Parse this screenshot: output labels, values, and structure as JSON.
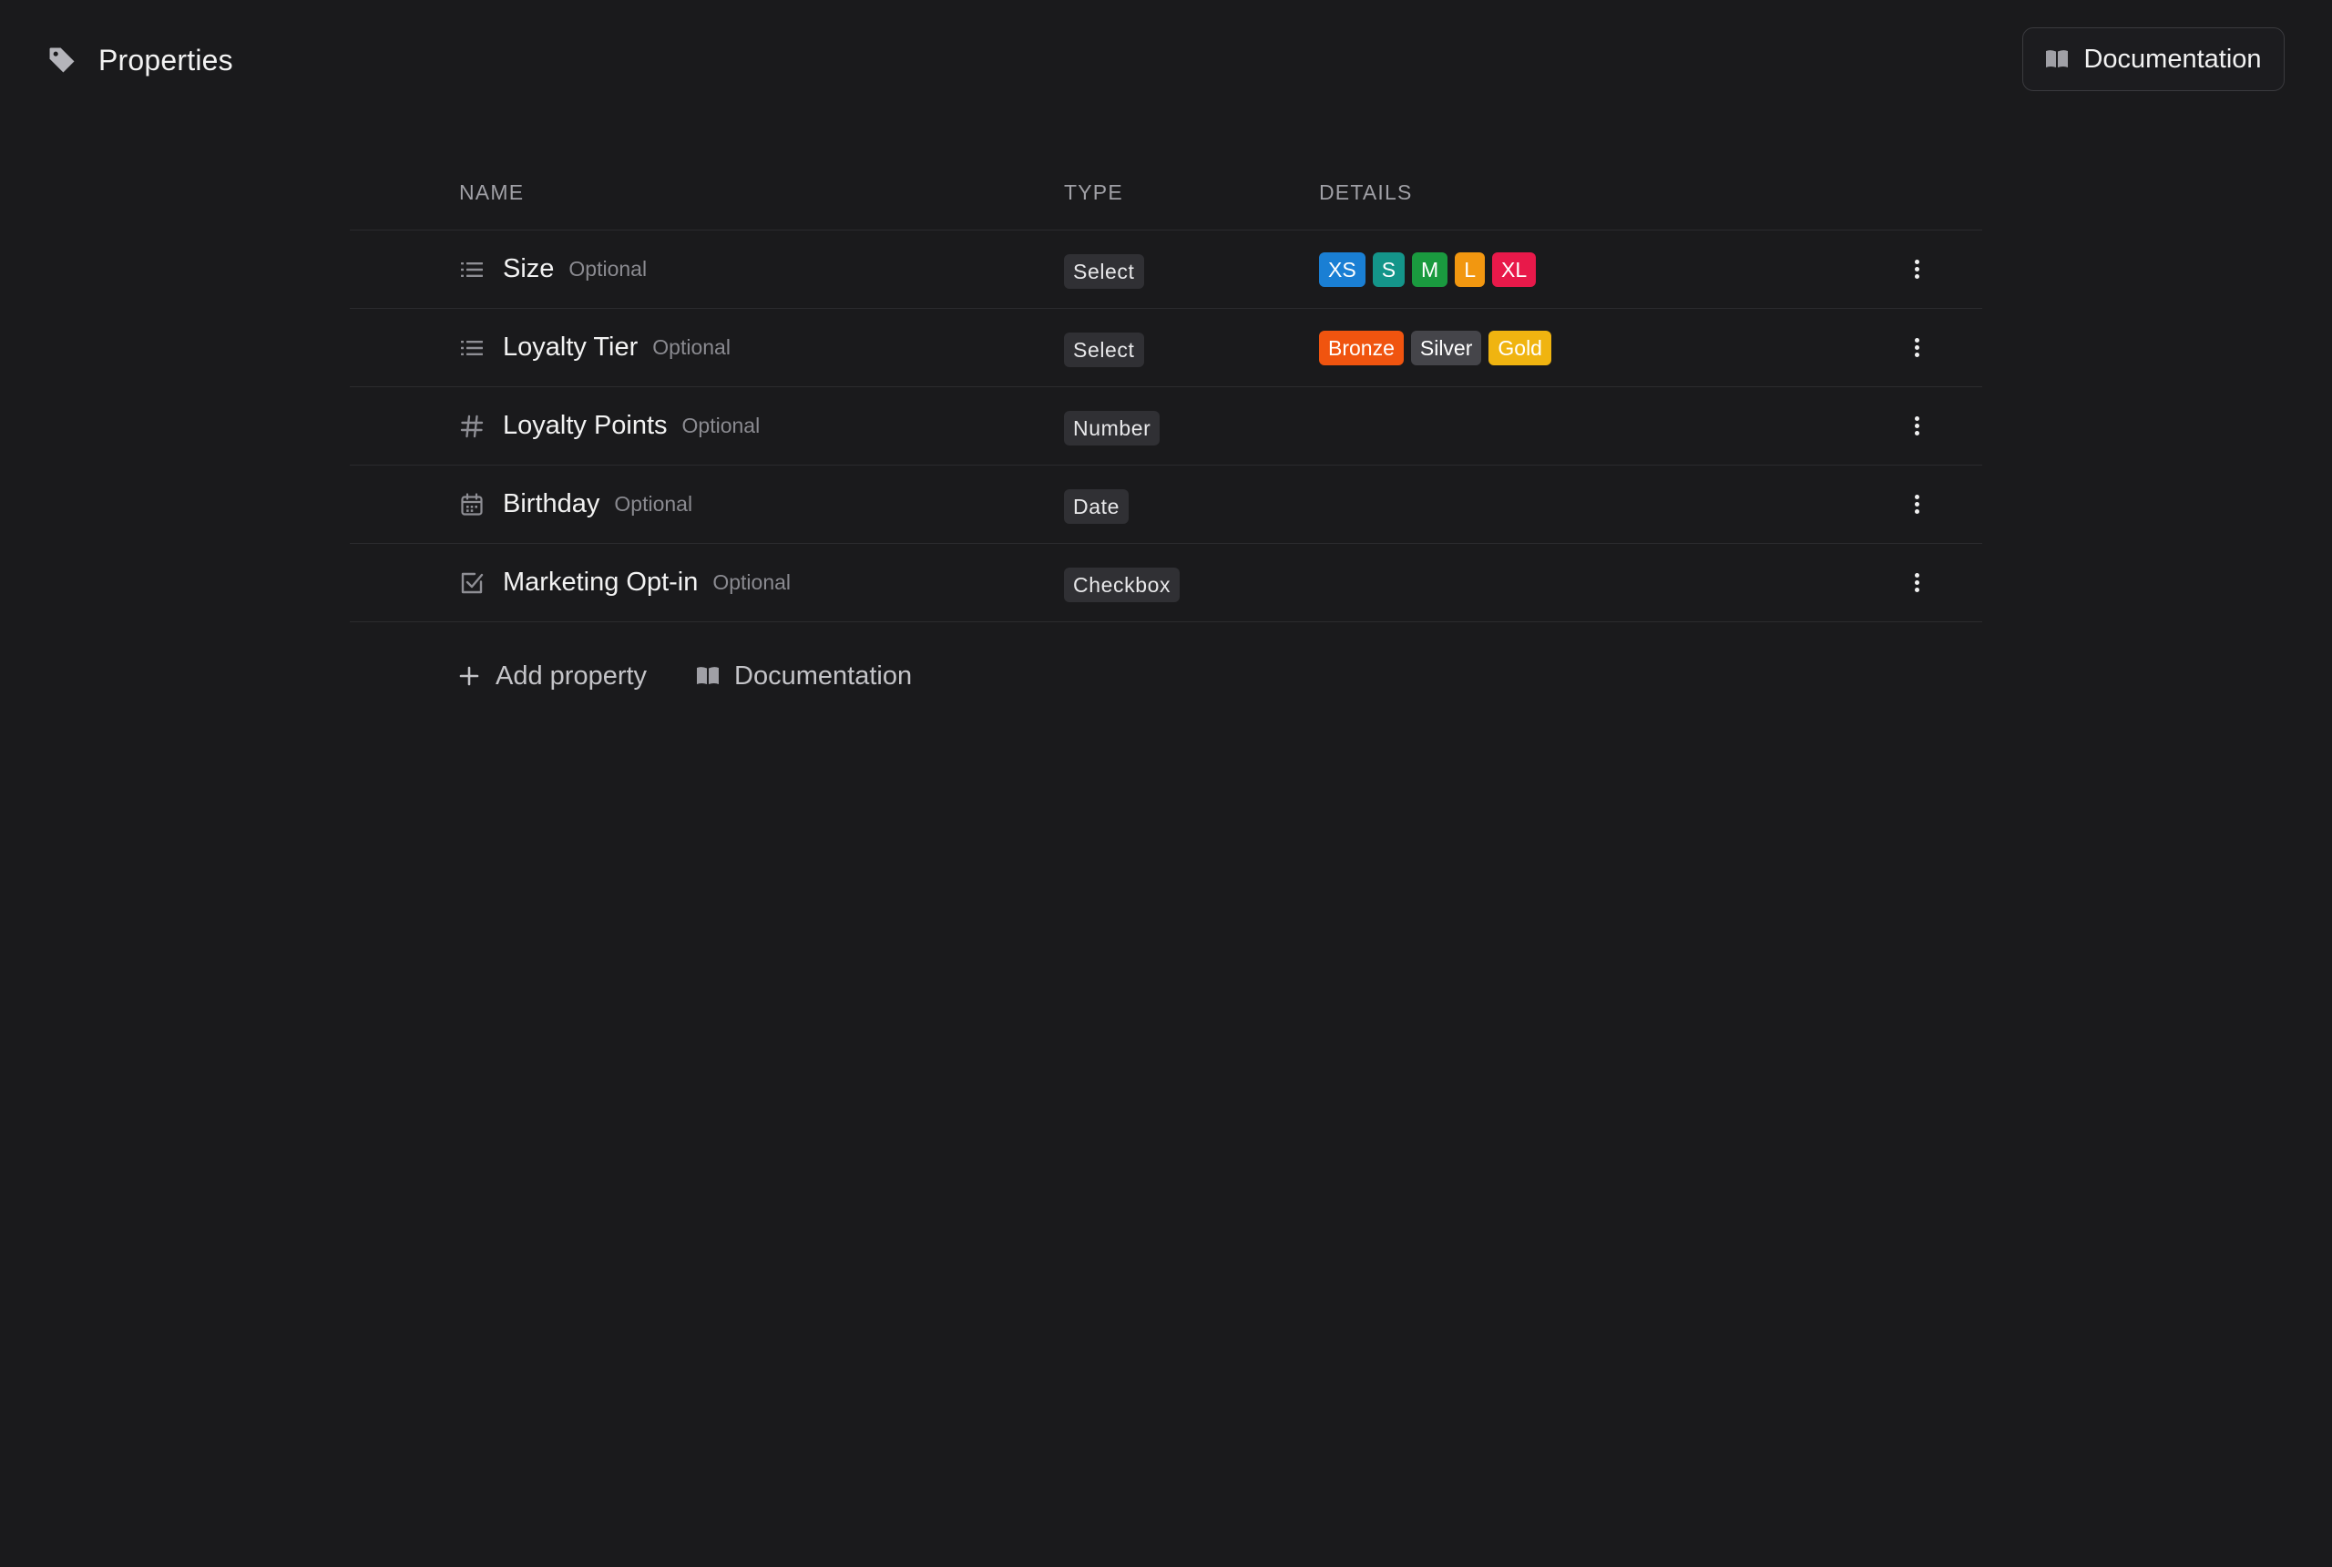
{
  "header": {
    "title": "Properties",
    "title_icon": "tag-icon",
    "documentation_label": "Documentation"
  },
  "table": {
    "columns": [
      "NAME",
      "TYPE",
      "DETAILS"
    ],
    "rows": [
      {
        "icon": "list-icon",
        "name": "Size",
        "optional_label": "Optional",
        "type": "Select",
        "details": [
          {
            "label": "XS",
            "color": "#1a7fd4"
          },
          {
            "label": "S",
            "color": "#14958a"
          },
          {
            "label": "M",
            "color": "#1a9a3f"
          },
          {
            "label": "L",
            "color": "#f29710"
          },
          {
            "label": "XL",
            "color": "#e8194a"
          }
        ]
      },
      {
        "icon": "list-icon",
        "name": "Loyalty Tier",
        "optional_label": "Optional",
        "type": "Select",
        "details": [
          {
            "label": "Bronze",
            "color": "#f0540f"
          },
          {
            "label": "Silver",
            "color": "#45454a"
          },
          {
            "label": "Gold",
            "color": "#f0b410"
          }
        ]
      },
      {
        "icon": "hash-icon",
        "name": "Loyalty Points",
        "optional_label": "Optional",
        "type": "Number",
        "details": []
      },
      {
        "icon": "calendar-icon",
        "name": "Birthday",
        "optional_label": "Optional",
        "type": "Date",
        "details": []
      },
      {
        "icon": "checkbox-icon",
        "name": "Marketing Opt-in",
        "optional_label": "Optional",
        "type": "Checkbox",
        "details": []
      }
    ]
  },
  "footer": {
    "add_property_label": "Add property",
    "documentation_label": "Documentation"
  },
  "colors": {
    "background": "#1a1a1c",
    "badge_background": "#303034",
    "divider": "#2b2b2e"
  }
}
